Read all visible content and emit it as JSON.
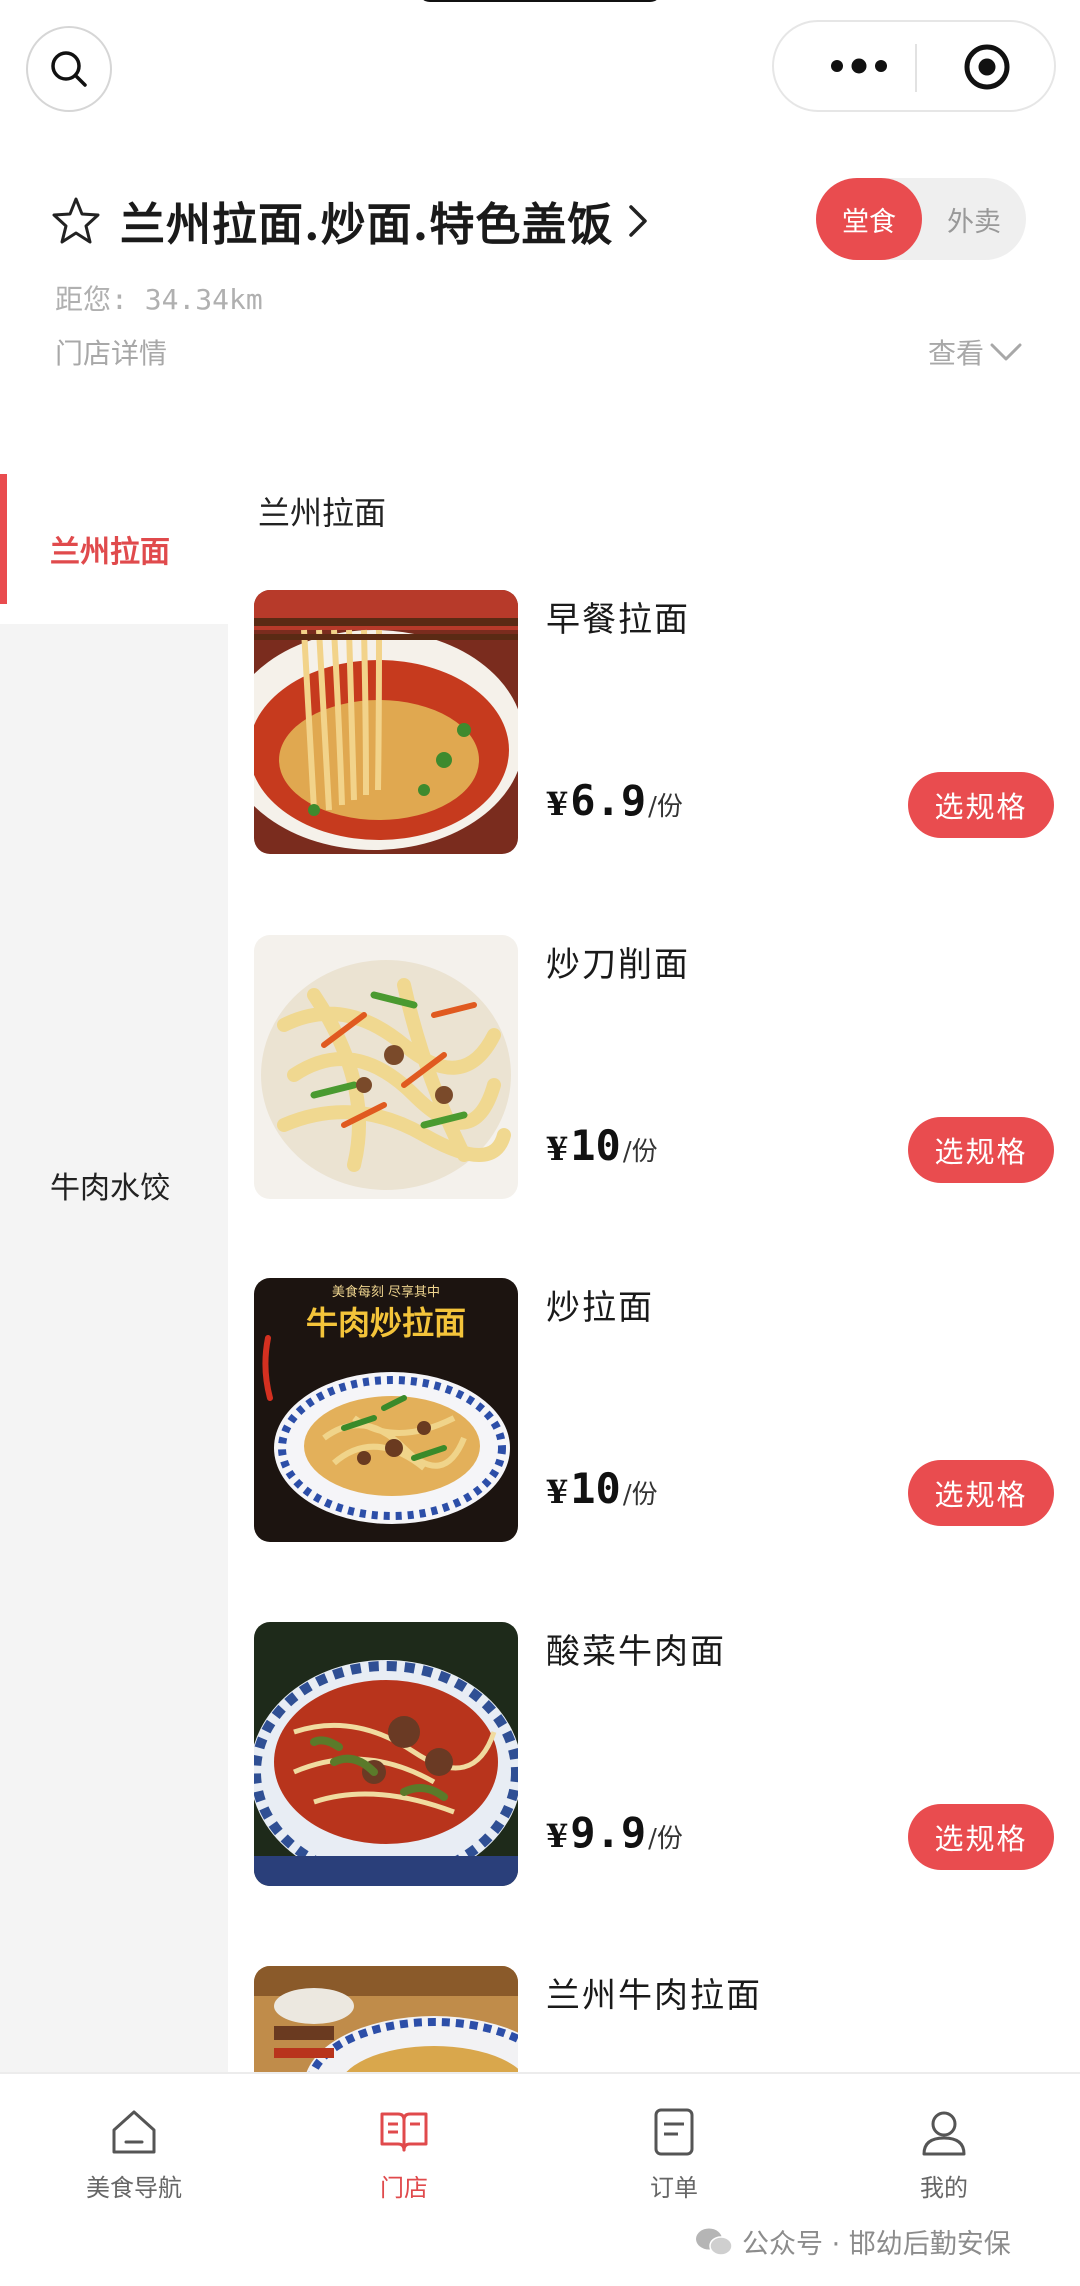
{
  "header": {
    "store_name": "兰州拉面.炒面.特色盖饭",
    "distance": "距您: 34.34km",
    "store_detail": "门店详情",
    "view_more": "查看"
  },
  "mode_toggle": {
    "dine_in": "堂食",
    "takeaway": "外卖",
    "selected": "堂食"
  },
  "sidebar": {
    "items": [
      {
        "label": "兰州拉面",
        "active": true
      },
      {
        "label": "牛肉水饺",
        "active": false
      }
    ]
  },
  "category": {
    "title": "兰州拉面"
  },
  "products": [
    {
      "name": "早餐拉面",
      "currency": "¥",
      "price": "6.9",
      "unit": "/份",
      "button": "选规格"
    },
    {
      "name": "炒刀削面",
      "currency": "¥",
      "price": "10",
      "unit": "/份",
      "button": "选规格"
    },
    {
      "name": "炒拉面",
      "currency": "¥",
      "price": "10",
      "unit": "/份",
      "button": "选规格",
      "image_text": "牛肉炒拉面",
      "image_caption": "美食每刻 尽享其中"
    },
    {
      "name": "酸菜牛肉面",
      "currency": "¥",
      "price": "9.9",
      "unit": "/份",
      "button": "选规格"
    },
    {
      "name": "兰州牛肉拉面"
    }
  ],
  "tabbar": {
    "items": [
      {
        "label": "美食导航",
        "icon": "home-icon"
      },
      {
        "label": "门店",
        "icon": "store-book-icon",
        "active": true
      },
      {
        "label": "订单",
        "icon": "order-icon"
      },
      {
        "label": "我的",
        "icon": "user-icon"
      }
    ]
  },
  "watermark": {
    "text": "公众号 · 邯幼后勤安保"
  },
  "colors": {
    "accent": "#e94c4f",
    "sidebar_bg": "#f4f4f4",
    "muted_text": "#a8a8a8"
  }
}
